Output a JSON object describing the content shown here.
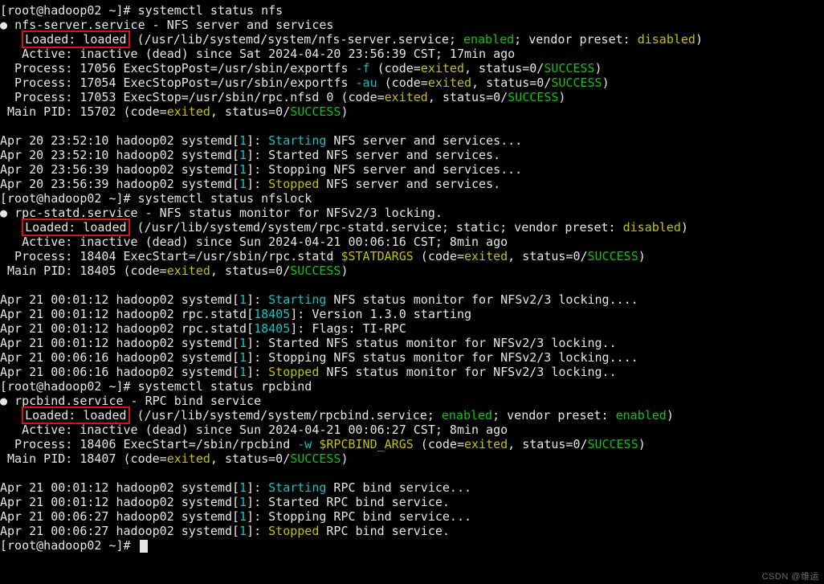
{
  "prompts": {
    "root": "[root@hadoop02 ~]# ",
    "cmd_nfs": "systemctl status nfs",
    "cmd_nfslock": "systemctl status nfslock",
    "cmd_rpcbind": "systemctl status rpcbind"
  },
  "nfs": {
    "unit_line": "nfs-server.service - NFS server and services",
    "loaded_label": "Loaded: loaded",
    "loaded_rest_a": " (/usr/lib/systemd/system/nfs-server.service; ",
    "enabled": "enabled",
    "loaded_rest_b": "; vendor preset: ",
    "disabled": "disabled",
    "loaded_rest_c": ")",
    "active": "   Active: inactive (dead) since Sat 2024-04-20 23:56:39 CST; 17min ago",
    "p1_a": "  Process: 17056 ExecStopPost=/usr/sbin/exportfs ",
    "p1_flag": "-f",
    "p1_b": " (code=",
    "exited": "exited",
    "p1_c": ", status=0/",
    "success": "SUCCESS",
    "close": ")",
    "p2_a": "  Process: 17054 ExecStopPost=/usr/sbin/exportfs ",
    "p2_flag": "-au",
    "p3_a": "  Process: 17053 ExecStop=/usr/sbin/rpc.nfsd 0 (code=",
    "pid_a": " Main PID: 15702 (code=",
    "log1_a": "Apr 20 23:52:10 hadoop02 systemd[",
    "one": "1",
    "log_close": "]: ",
    "starting": "Starting",
    "log1_b": " NFS server and services...",
    "log2": "Apr 20 23:52:10 hadoop02 systemd[",
    "log2_b": "]: Started NFS server and services.",
    "log3": "Apr 20 23:56:39 hadoop02 systemd[",
    "log3_b": "]: Stopping NFS server and services...",
    "log4": "Apr 20 23:56:39 hadoop02 systemd[",
    "stopped": "Stopped",
    "log4_b": " NFS server and services."
  },
  "nfslock": {
    "unit_line": "rpc-statd.service - NFS status monitor for NFSv2/3 locking.",
    "loaded_label": "Loaded: loaded",
    "loaded_rest": " (/usr/lib/systemd/system/rpc-statd.service; static; vendor preset: ",
    "disabled": "disabled",
    "close": ")",
    "active": "   Active: inactive (dead) since Sun 2024-04-21 00:06:16 CST; 8min ago",
    "p1_a": "  Process: 18404 ExecStart=/usr/sbin/rpc.statd ",
    "statdargs": "$STATDARGS",
    "p1_b": " (code=",
    "pid_a": " Main PID: 18405 (code=",
    "l1_a": "Apr 21 00:01:12 hadoop02 systemd[",
    "l1_b": " NFS status monitor for NFSv2/3 locking....",
    "l2_a": "Apr 21 00:01:12 hadoop02 rpc.statd[",
    "pid_18405": "18405",
    "l2_b": "]: Version 1.3.0 starting",
    "l3_a": "Apr 21 00:01:12 hadoop02 rpc.statd[",
    "l3_b": "]: Flags: TI-RPC",
    "l4_a": "Apr 21 00:01:12 hadoop02 systemd[",
    "l4_b": "]: Started NFS status monitor for NFSv2/3 locking..",
    "l5_a": "Apr 21 00:06:16 hadoop02 systemd[",
    "l5_b": "]: Stopping NFS status monitor for NFSv2/3 locking....",
    "l6_a": "Apr 21 00:06:16 hadoop02 systemd[",
    "l6_b": " NFS status monitor for NFSv2/3 locking.."
  },
  "rpcbind": {
    "unit_line": "rpcbind.service - RPC bind service",
    "loaded_label": "Loaded: loaded",
    "loaded_rest_a": " (/usr/lib/systemd/system/rpcbind.service; ",
    "enabled": "enabled",
    "loaded_rest_b": "; vendor preset: ",
    "enabled2": "enabled",
    "close": ")",
    "active": "   Active: inactive (dead) since Sun 2024-04-21 00:06:27 CST; 8min ago",
    "p1_a": "  Process: 18406 ExecStart=/sbin/rpcbind ",
    "wflag": "-w",
    "space": " ",
    "rpcargs": "$RPCBIND_ARGS",
    "p1_b": " (code=",
    "pid_a": " Main PID: 18407 (code=",
    "l1_a": "Apr 21 00:01:12 hadoop02 systemd[",
    "l1_b": " RPC bind service...",
    "l2_a": "Apr 21 00:01:12 hadoop02 systemd[",
    "l2_b": "]: Started RPC bind service.",
    "l3_a": "Apr 21 00:06:27 hadoop02 systemd[",
    "l3_b": "]: Stopping RPC bind service...",
    "l4_a": "Apr 21 00:06:27 hadoop02 systemd[",
    "l4_b": " RPC bind service."
  },
  "watermark": "CSDN @维运"
}
